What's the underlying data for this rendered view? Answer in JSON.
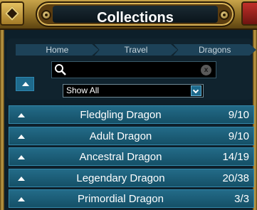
{
  "header": {
    "title": "Collections"
  },
  "breadcrumb": [
    "Home",
    "Travel",
    "Dragons"
  ],
  "search": {
    "value": "",
    "clear_label": "x"
  },
  "filter": {
    "selected": "Show All"
  },
  "rows": [
    {
      "name": "Fledgling Dragon",
      "count": "9/10"
    },
    {
      "name": "Adult Dragon",
      "count": "9/10"
    },
    {
      "name": "Ancestral Dragon",
      "count": "14/19"
    },
    {
      "name": "Legendary Dragon",
      "count": "20/38"
    },
    {
      "name": "Primordial Dragon",
      "count": "3/3"
    }
  ],
  "icons": {
    "search": "search-icon",
    "collapse": "triangle-up-icon",
    "dropdown": "chevron-down-icon",
    "menu": "diamond-icon",
    "close": "close-icon"
  }
}
